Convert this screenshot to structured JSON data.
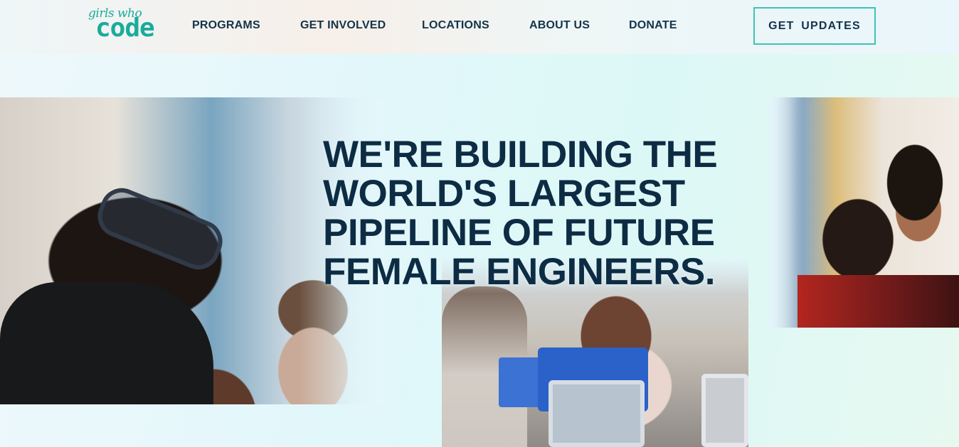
{
  "header": {
    "logo": {
      "script_text": "girls who",
      "word_text": "code"
    },
    "nav": [
      {
        "label": "PROGRAMS"
      },
      {
        "label": "GET INVOLVED"
      },
      {
        "label": "LOCATIONS"
      },
      {
        "label": "ABOUT US"
      },
      {
        "label": "DONATE"
      }
    ],
    "cta_label": "GET UPDATES"
  },
  "hero": {
    "headline_lines": [
      "WE'RE BUILDING THE",
      "WORLD'S LARGEST",
      "PIPELINE OF FUTURE",
      "FEMALE ENGINEERS."
    ]
  },
  "colors": {
    "brand_teal": "#1aab9b",
    "button_border": "#3fc3b3",
    "text_navy": "#0d2c44"
  }
}
